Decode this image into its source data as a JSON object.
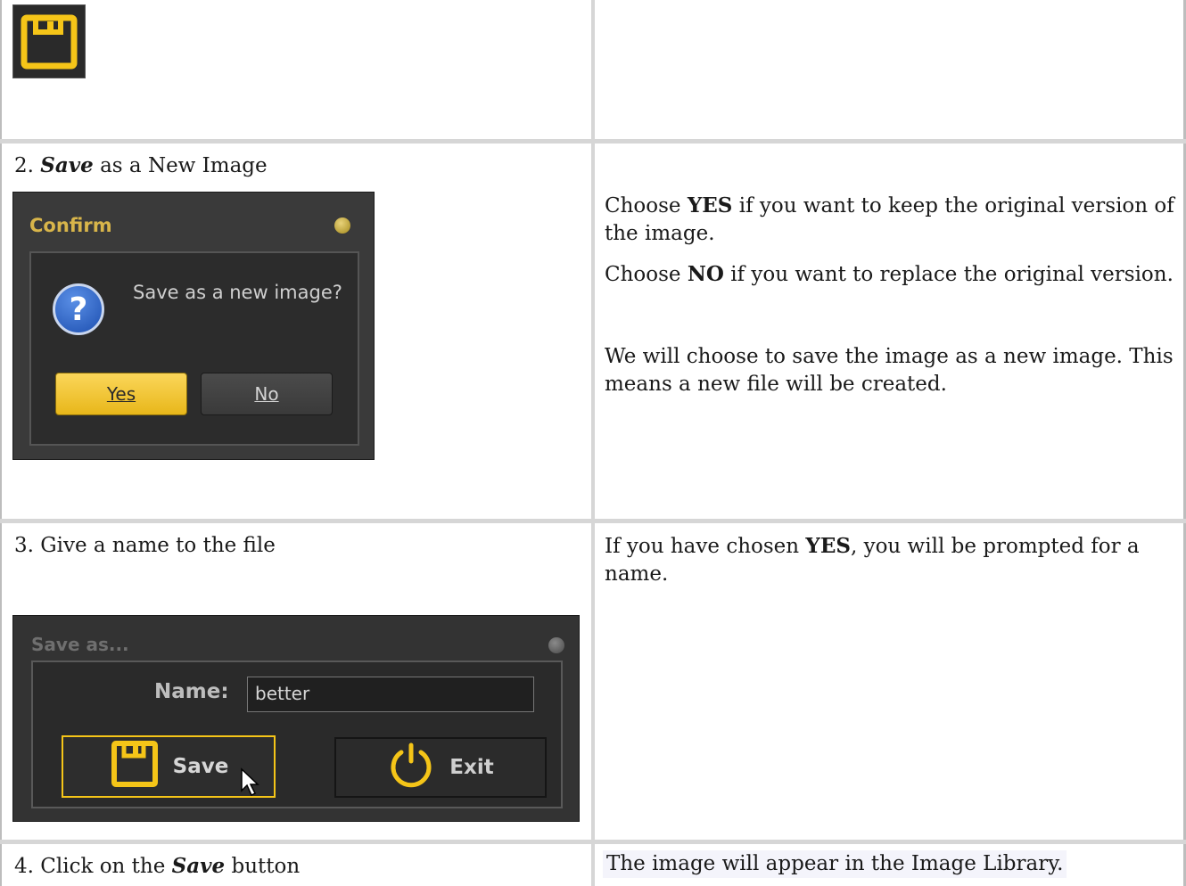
{
  "row2": {
    "step_num": "2.",
    "step_em": "Save",
    "step_rest": "as a New Image",
    "confirm_dialog": {
      "title": "Confirm",
      "message": "Save as a new image?",
      "yes_label": "Yes",
      "no_label": "No"
    },
    "desc": {
      "p1_a": "Choose ",
      "p1_b": "YES",
      "p1_c": " if you want to keep the original version of the image.",
      "p2_a": "Choose ",
      "p2_b": "NO",
      "p2_c": " if you want to replace the original version.",
      "p3": "We will choose to save the image as a new image. This means a new file will be created."
    }
  },
  "row3": {
    "step_text": "3. Give a name to the file",
    "saveas_dialog": {
      "title": "Save as...",
      "name_label": "Name:",
      "name_value": "better",
      "save_label": "Save",
      "exit_label": "Exit"
    },
    "desc": {
      "a": "If you have chosen ",
      "b": "YES",
      "c": ", you will be prompted for a name."
    }
  },
  "row4": {
    "step_num": "4. Click on the ",
    "step_em": "Save",
    "step_rest": " button",
    "desc": "The image will appear in the Image Library."
  },
  "colors": {
    "accent_yellow": "#f5c518",
    "dialog_bg": "#2f2f2f",
    "highlight": "#f4f4fb"
  }
}
